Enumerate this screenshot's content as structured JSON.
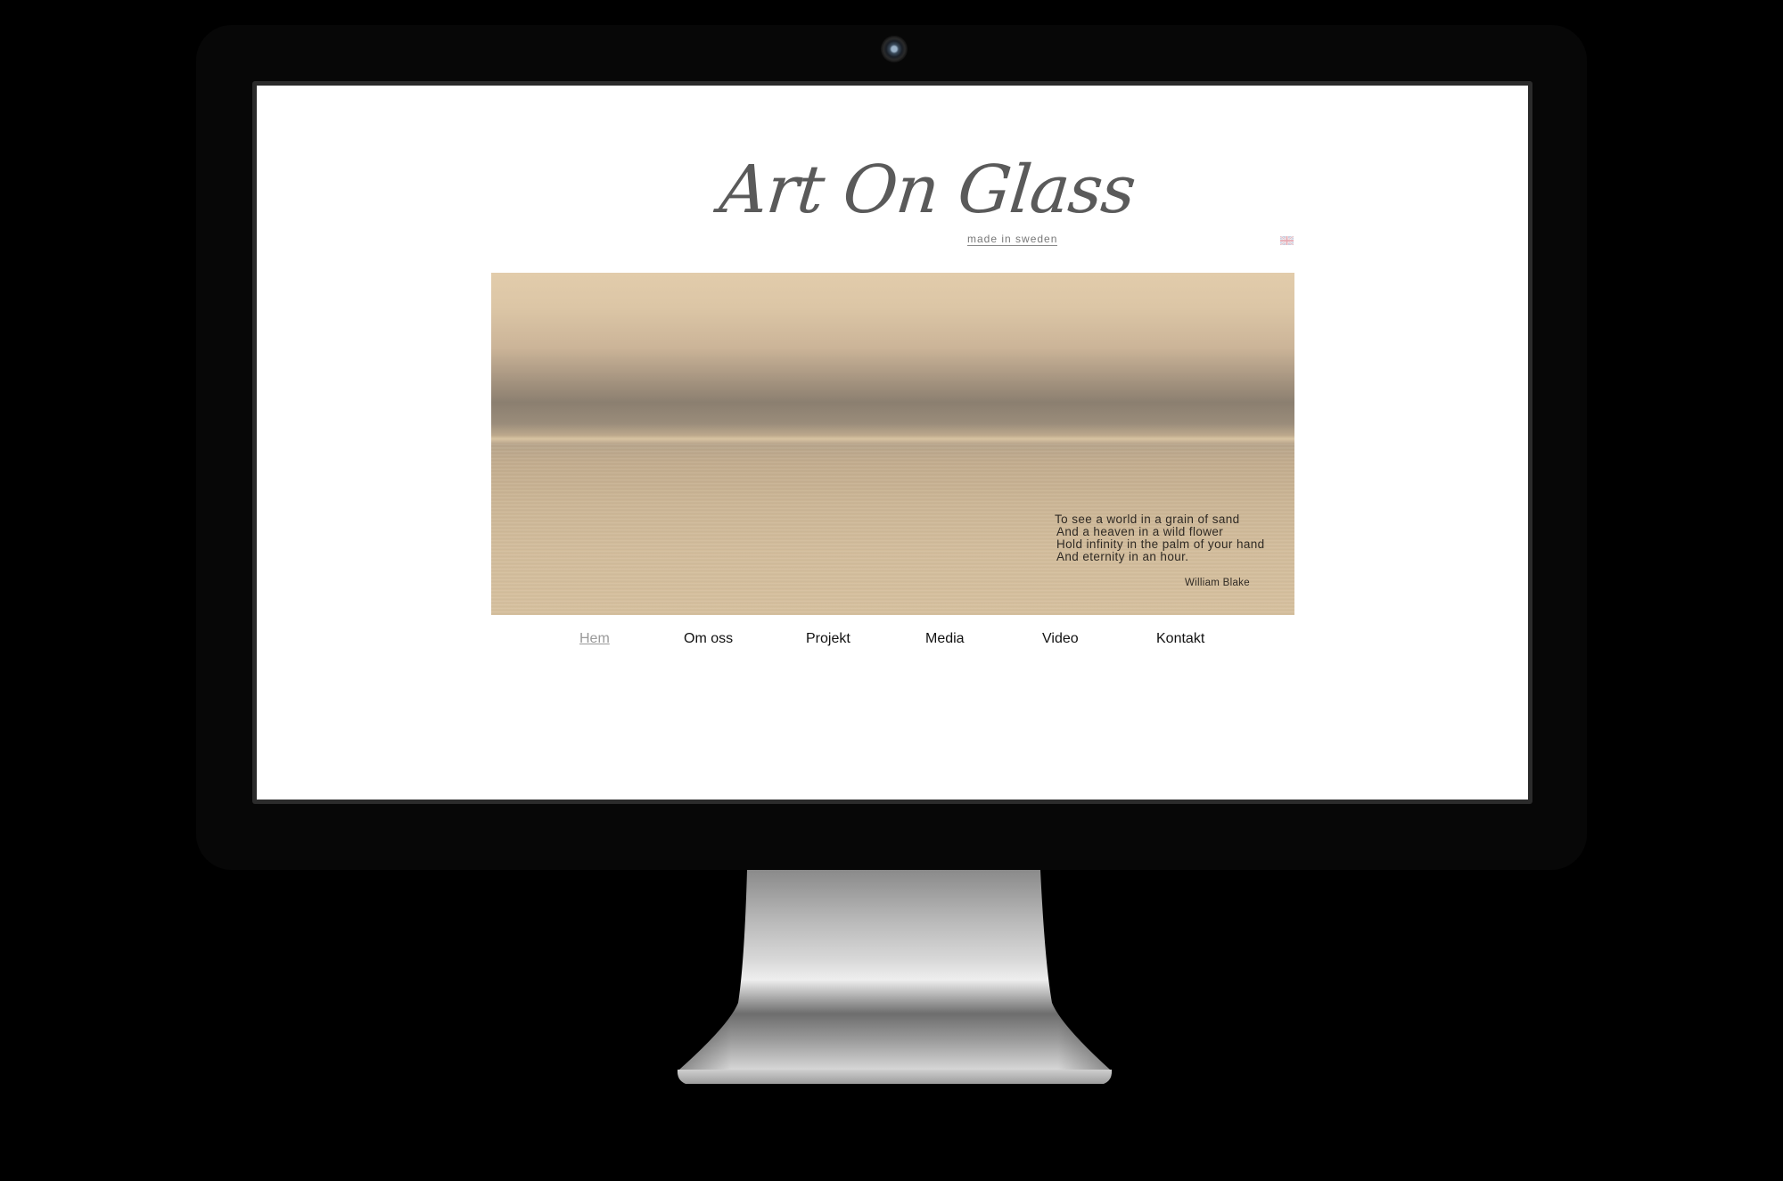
{
  "site": {
    "logo_title": "Art On Glass",
    "logo_tagline": "made in sweden",
    "language_flag_icon": "uk-flag-icon"
  },
  "hero": {
    "quote_lines": [
      "To see a world in a grain of sand",
      "And a heaven in a wild flower",
      "Hold infinity in the palm of your hand",
      "And eternity in an hour."
    ],
    "quote_author": "William Blake"
  },
  "nav": {
    "items": [
      {
        "label": "Hem",
        "active": true
      },
      {
        "label": "Om oss",
        "active": false
      },
      {
        "label": "Projekt",
        "active": false
      },
      {
        "label": "Media",
        "active": false
      },
      {
        "label": "Video",
        "active": false
      },
      {
        "label": "Kontakt",
        "active": false
      }
    ]
  },
  "colors": {
    "background": "#000000",
    "bezel": "#070707",
    "page": "#ffffff",
    "nav_active": "#999999",
    "nav_text": "#111111",
    "logo": "#5a5a5a"
  }
}
